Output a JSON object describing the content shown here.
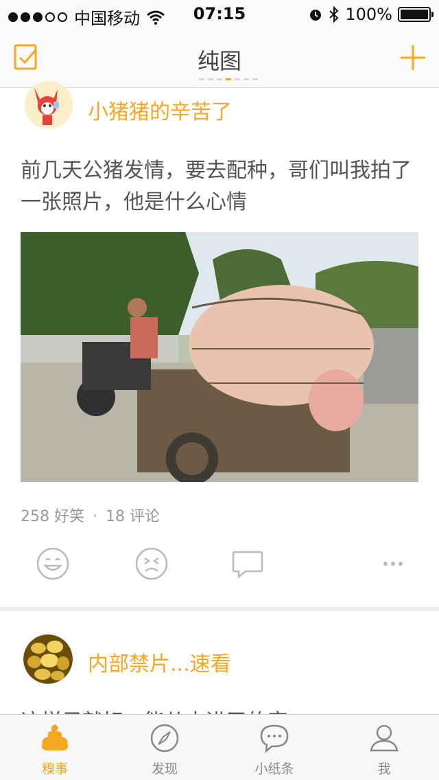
{
  "status_bar": {
    "carrier": "中国移动",
    "time": "07:15",
    "battery": "100%"
  },
  "nav": {
    "title": "纯图",
    "left_icon": "checkin-icon",
    "right_icon": "plus-icon"
  },
  "posts": [
    {
      "author": "小猪猪的辛苦了",
      "content": "前几天公猪发情，要去配种，哥们叫我拍了一张照片，他是什么心情",
      "stats": {
        "likes": "258 好笑",
        "separator": "·",
        "comments": "18 评论"
      },
      "actions": [
        "smile-icon",
        "frown-icon",
        "comment-icon",
        "more-icon"
      ]
    },
    {
      "author": "内部禁片...速看",
      "content": "这样子就好，能从未进了的字"
    }
  ],
  "tabs": [
    {
      "label": "糗事",
      "icon": "poop-icon",
      "active": true
    },
    {
      "label": "发现",
      "icon": "compass-icon",
      "active": false
    },
    {
      "label": "小纸条",
      "icon": "chat-icon",
      "active": false
    },
    {
      "label": "我",
      "icon": "user-icon",
      "active": false
    }
  ],
  "colors": {
    "accent": "#f5a623",
    "text": "#555555",
    "muted": "#999999"
  }
}
